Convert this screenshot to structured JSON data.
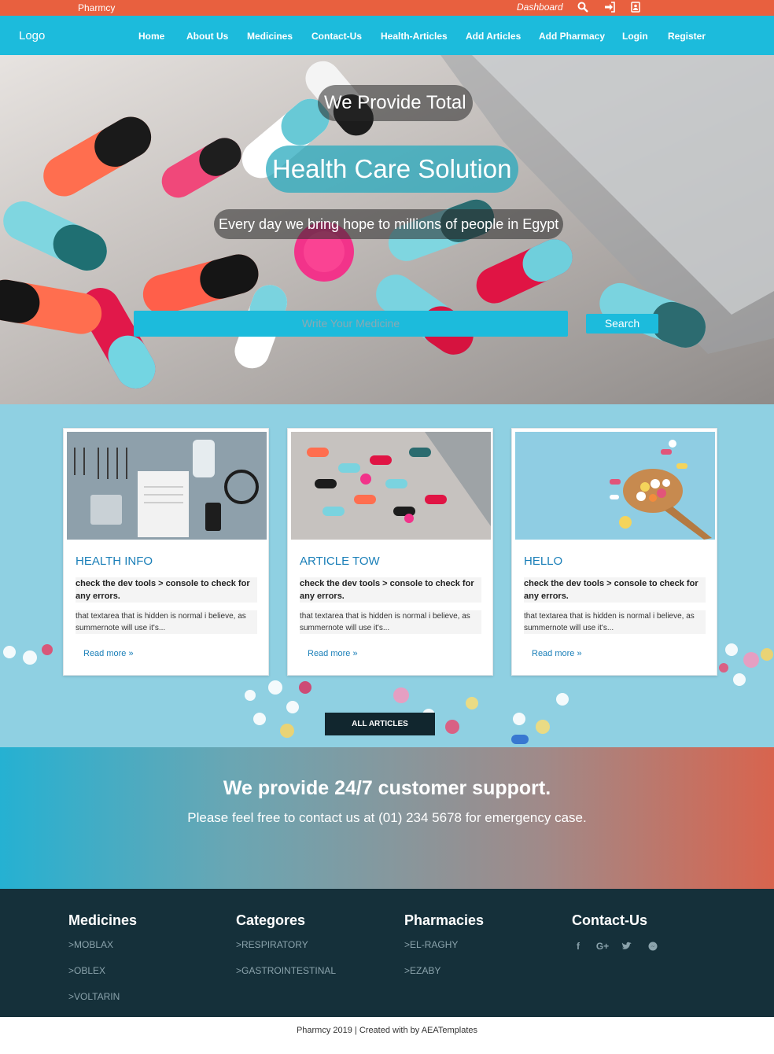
{
  "topbar": {
    "brand": "Pharmcy",
    "dashboard": "Dashboard",
    "icons": [
      "search-icon",
      "sign-in-icon",
      "user-card-icon"
    ]
  },
  "nav": {
    "logo": "Logo",
    "items": [
      "Home",
      "About Us",
      "Medicines",
      "Contact-Us",
      "Health-Articles",
      "Add Articles",
      "Add Pharmacy",
      "Login",
      "Register"
    ]
  },
  "hero": {
    "line1": "We Provide Total",
    "line2": "Health Care Solution",
    "line3": "Every day we bring hope to millions of people in Egypt",
    "search_placeholder": "Write Your Medicine",
    "search_button": "Search"
  },
  "articles": {
    "cards": [
      {
        "title": "HEALTH INFO",
        "bold": "check the dev tools > console to check for any errors.",
        "body": "that textarea that is hidden is normal i believe, as summernote will use it's...",
        "more": "Read more »"
      },
      {
        "title": "ARTICLE TOW",
        "bold": "check the dev tools > console to check for any errors.",
        "body": "that textarea that is hidden is normal i believe, as summernote will use it's...",
        "more": "Read more »"
      },
      {
        "title": "HELLO",
        "bold": "check the dev tools > console to check for any errors.",
        "body": "that textarea that is hidden is normal i believe, as summernote will use it's...",
        "more": "Read more »"
      }
    ],
    "all_button": "ALL ARTICLES"
  },
  "support": {
    "heading": "We provide 24/7 customer support.",
    "text": "Please feel free to contact us at (01) 234 5678 for emergency case."
  },
  "footer": {
    "columns": [
      {
        "heading": "Medicines",
        "links": [
          "MOBLAX",
          "OBLEX",
          "VOLTARIN"
        ]
      },
      {
        "heading": "Categores",
        "links": [
          "RESPIRATORY",
          "GASTROINTESTINAL"
        ]
      },
      {
        "heading": "Pharmacies",
        "links": [
          "EL-RAGHY",
          "EZABY"
        ]
      },
      {
        "heading": "Contact-Us",
        "links": []
      }
    ],
    "social_icons": [
      "facebook-icon",
      "google-plus-icon",
      "twitter-icon",
      "messenger-icon"
    ],
    "link_prefix": ">"
  },
  "copyright": "Pharmcy 2019 | Created with by AEATemplates",
  "colors": {
    "topbar": "#e8603f",
    "nav": "#1cbbdc",
    "footer": "#15303a",
    "card_title": "#1a7fb8"
  }
}
